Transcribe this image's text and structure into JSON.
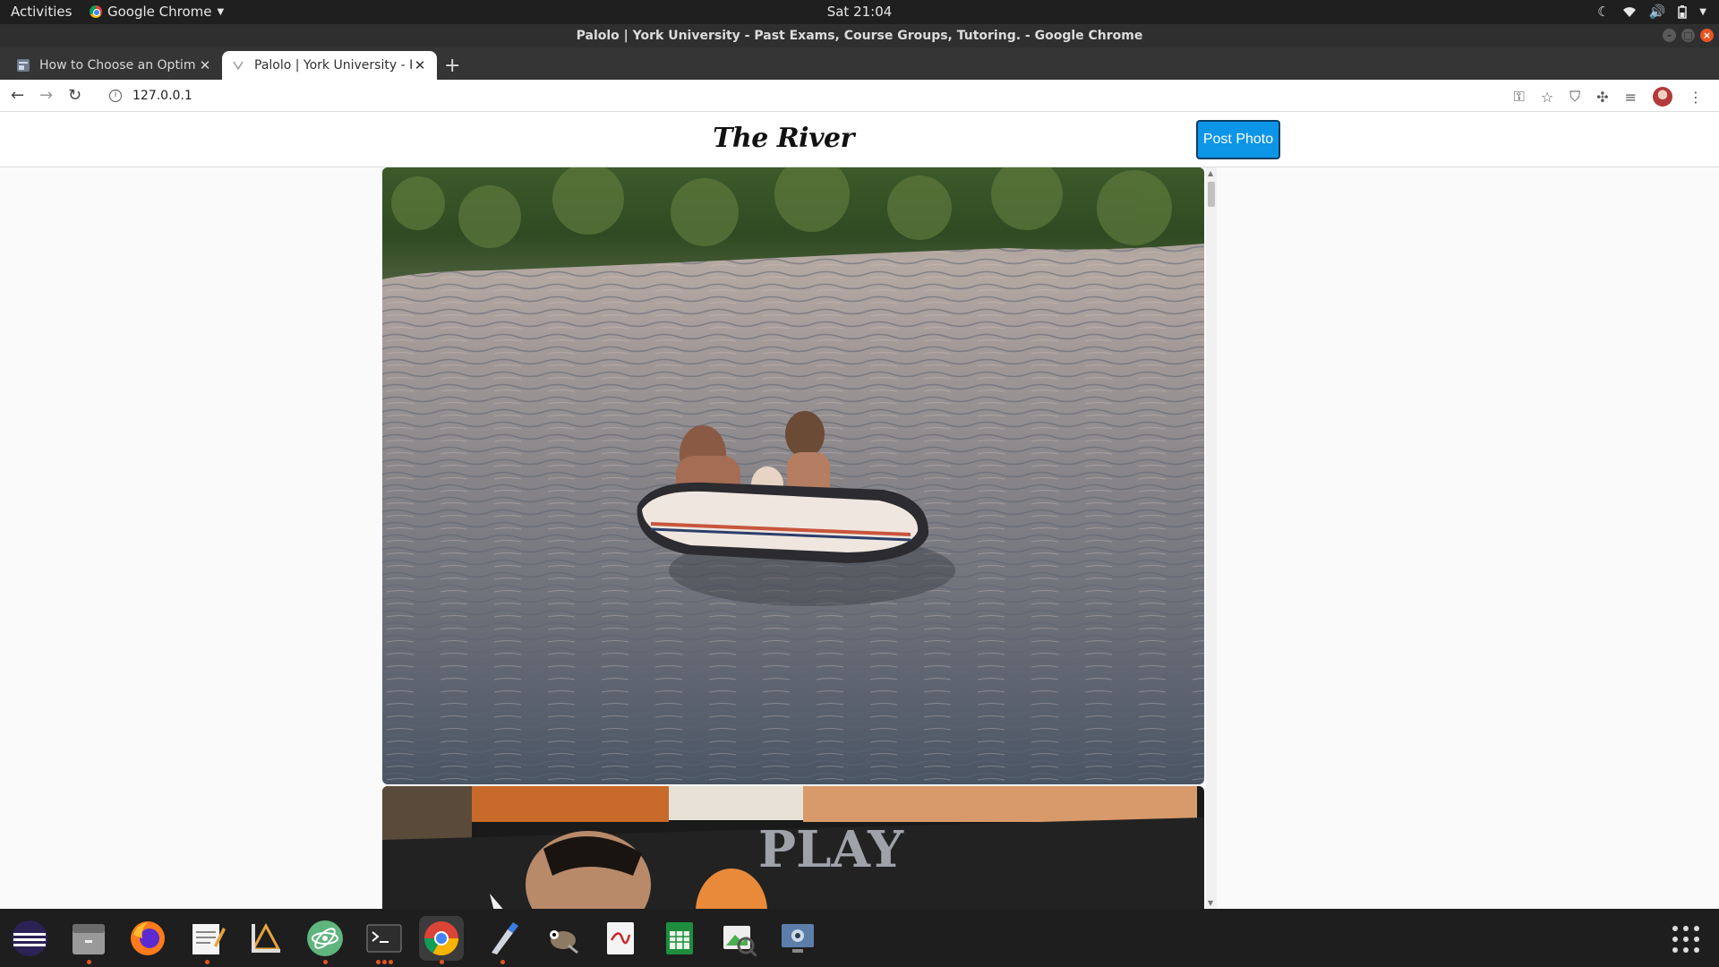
{
  "topbar": {
    "activities": "Activities",
    "app_name": "Google Chrome",
    "clock": "Sat 21:04"
  },
  "window": {
    "title": "Palolo | York University - Past Exams, Course Groups, Tutoring. - Google Chrome"
  },
  "tabs": [
    {
      "label": "How to Choose an Optim",
      "active": false
    },
    {
      "label": "Palolo | York University - P",
      "active": true
    }
  ],
  "toolbar": {
    "url": "127.0.0.1"
  },
  "site": {
    "logo": "The River",
    "post_button": "Post Photo"
  },
  "dock": {
    "apps": [
      "eclipse-icon",
      "files-icon",
      "firefox-icon",
      "text-editor-icon",
      "inkscape-icon",
      "atom-icon",
      "terminal-icon",
      "chrome-icon",
      "color-picker-icon",
      "gimp-icon",
      "pdf-viewer-icon",
      "spreadsheet-icon",
      "image-viewer-icon",
      "screenshot-icon"
    ]
  }
}
